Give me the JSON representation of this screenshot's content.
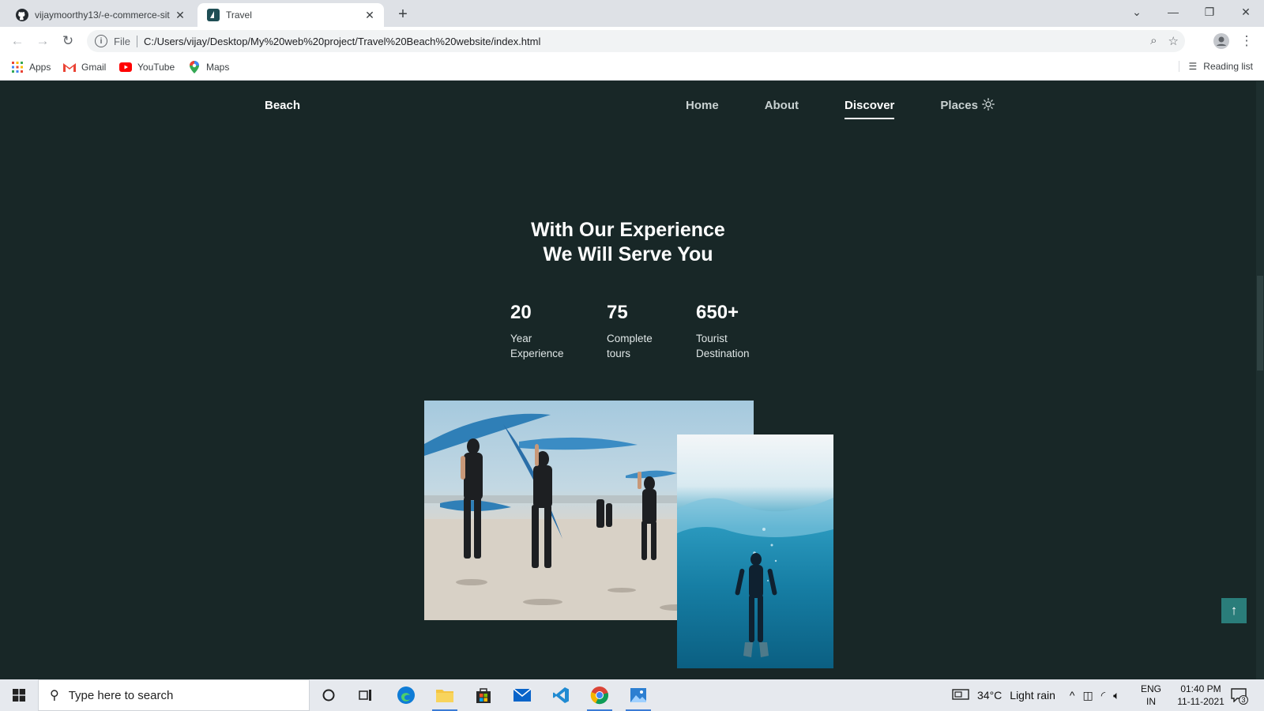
{
  "browser": {
    "tabs": [
      {
        "title": "vijaymoorthy13/-e-commerce-sit",
        "icon": "github-icon"
      },
      {
        "title": "Travel",
        "icon": "site-favicon",
        "active": true
      }
    ],
    "address": {
      "scheme_label": "File",
      "url": "C:/Users/vijay/Desktop/My%20web%20project/Travel%20Beach%20website/index.html"
    },
    "bookmarks": [
      {
        "label": "Apps",
        "icon": "apps-grid-icon"
      },
      {
        "label": "Gmail",
        "icon": "gmail-icon"
      },
      {
        "label": "YouTube",
        "icon": "youtube-icon"
      },
      {
        "label": "Maps",
        "icon": "maps-icon"
      }
    ],
    "reading_list_label": "Reading list"
  },
  "site": {
    "logo": "Beach",
    "nav": [
      {
        "label": "Home",
        "active": false
      },
      {
        "label": "About",
        "active": false
      },
      {
        "label": "Discover",
        "active": true
      },
      {
        "label": "Places",
        "active": false
      }
    ],
    "heading_line1": "With Our Experience",
    "heading_line2": "We Will Serve You",
    "stats": [
      {
        "number": "20",
        "label_line1": "Year",
        "label_line2": "Experience"
      },
      {
        "number": "75",
        "label_line1": "Complete",
        "label_line2": "tours"
      },
      {
        "number": "650+",
        "label_line1": "Tourist",
        "label_line2": "Destination"
      }
    ],
    "images": [
      "surfers-on-beach-photo",
      "underwater-diver-photo"
    ],
    "colors": {
      "background": "#182727",
      "accent": "#2a7d7a",
      "text": "#ffffff"
    }
  },
  "taskbar": {
    "search_placeholder": "Type here to search",
    "weather_temp": "34°C",
    "weather_text": "Light rain",
    "lang_line1": "ENG",
    "lang_line2": "IN",
    "time": "01:40 PM",
    "date": "11-11-2021",
    "notifications_count": "3"
  }
}
